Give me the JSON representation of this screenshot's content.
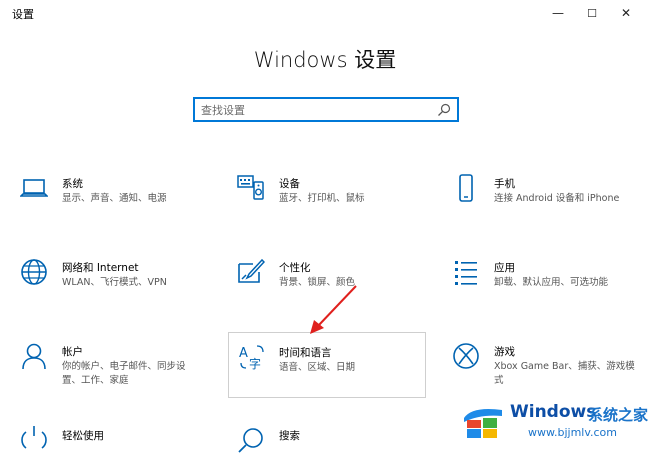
{
  "window": {
    "app_title": "设置",
    "minimize": "—",
    "maximize": "☐",
    "close": "✕"
  },
  "page_title": "Windows 设置",
  "search": {
    "placeholder": "查找设置"
  },
  "tiles": [
    {
      "title": "系统",
      "desc": "显示、声音、通知、电源",
      "icon": "laptop-icon"
    },
    {
      "title": "设备",
      "desc": "蓝牙、打印机、鼠标",
      "icon": "devices-icon"
    },
    {
      "title": "手机",
      "desc": "连接 Android 设备和 iPhone",
      "icon": "phone-icon"
    },
    {
      "title": "网络和 Internet",
      "desc": "WLAN、飞行模式、VPN",
      "icon": "globe-icon"
    },
    {
      "title": "个性化",
      "desc": "背景、锁屏、颜色",
      "icon": "personalization-icon"
    },
    {
      "title": "应用",
      "desc": "卸载、默认应用、可选功能",
      "icon": "apps-icon"
    },
    {
      "title": "帐户",
      "desc": "你的帐户、电子邮件、同步设置、工作、家庭",
      "icon": "person-icon"
    },
    {
      "title": "时间和语言",
      "desc": "语音、区域、日期",
      "icon": "time-language-icon"
    },
    {
      "title": "游戏",
      "desc": "Xbox Game Bar、捕获、游戏模式",
      "icon": "xbox-icon"
    },
    {
      "title": "轻松使用",
      "desc": "",
      "icon": "ease-of-access-icon"
    },
    {
      "title": "搜索",
      "desc": "",
      "icon": "search-category-icon"
    }
  ],
  "watermark": {
    "brand": "Windows",
    "brand_cn": "系统之家",
    "url": "www.bjjmlv.com"
  },
  "colors": {
    "accent": "#0078d7",
    "arrow": "#e0201d"
  }
}
